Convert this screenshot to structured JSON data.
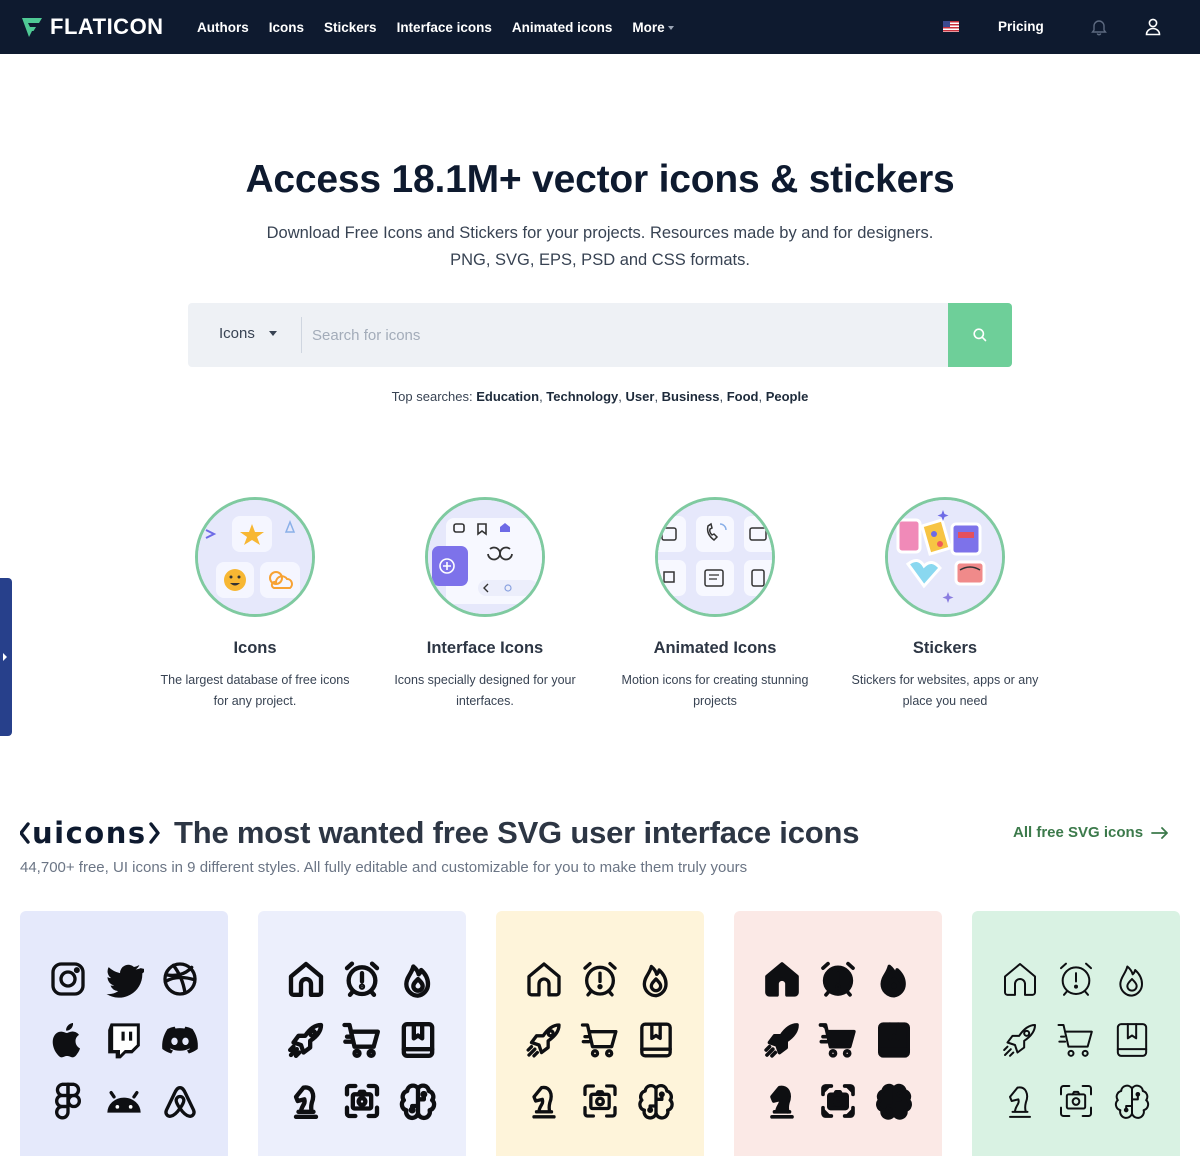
{
  "header": {
    "logo_text": "FLATICON",
    "nav": [
      "Authors",
      "Icons",
      "Stickers",
      "Interface icons",
      "Animated icons",
      "More"
    ],
    "pricing": "Pricing"
  },
  "hero": {
    "title": "Access 18.1M+ vector icons & stickers",
    "subtitle_line1": "Download Free Icons and Stickers for your projects. Resources made by and for designers.",
    "subtitle_line2": "PNG, SVG, EPS, PSD and CSS formats."
  },
  "search": {
    "type_label": "Icons",
    "placeholder": "Search for icons"
  },
  "top_searches": {
    "label": "Top searches:",
    "items": [
      "Education",
      "Technology",
      "User",
      "Business",
      "Food",
      "People"
    ]
  },
  "categories": [
    {
      "title": "Icons",
      "desc_line1": "The largest database of free icons",
      "desc_line2": "for any project."
    },
    {
      "title": "Interface Icons",
      "desc_line1": "Icons specially designed for your",
      "desc_line2": "interfaces."
    },
    {
      "title": "Animated Icons",
      "desc_line1": "Motion icons for creating stunning",
      "desc_line2": "projects"
    },
    {
      "title": "Stickers",
      "desc_line1": "Stickers for websites, apps or any",
      "desc_line2": "place you need"
    }
  ],
  "uicons": {
    "logo_text": "uicons",
    "title": "The most wanted free SVG user interface icons",
    "subtitle": "44,700+ free, UI icons in 9 different styles. All fully editable and customizable for you to make them truly yours",
    "all_link": "All free SVG icons"
  },
  "cards": [
    {
      "bg": "#e5e9fb",
      "icons": [
        "instagram-icon",
        "twitter-icon",
        "dribbble-icon",
        "apple-icon",
        "twitch-icon",
        "discord-icon",
        "figma-icon",
        "android-icon",
        "airbnb-icon"
      ]
    },
    {
      "bg": "#eceffc",
      "icons": [
        "home-icon",
        "alarm-icon",
        "flame-icon",
        "rocket-icon",
        "cart-icon",
        "book-icon",
        "chess-knight-icon",
        "camera-icon",
        "brain-icon"
      ]
    },
    {
      "bg": "#fef4da",
      "icons": [
        "home-icon",
        "alarm-icon",
        "flame-icon",
        "rocket-icon",
        "cart-icon",
        "book-icon",
        "chess-knight-icon",
        "camera-icon",
        "brain-icon"
      ]
    },
    {
      "bg": "#fbe9e6",
      "icons": [
        "home-icon",
        "alarm-icon",
        "flame-icon",
        "rocket-icon",
        "cart-icon",
        "book-icon",
        "chess-knight-icon",
        "camera-icon",
        "brain-icon"
      ]
    },
    {
      "bg": "#d9f2e3",
      "icons": [
        "home-icon",
        "alarm-icon",
        "flame-icon",
        "rocket-icon",
        "cart-icon",
        "book-icon",
        "chess-knight-icon",
        "camera-icon",
        "brain-icon"
      ]
    }
  ],
  "colors": {
    "header_bg": "#0e1a2f",
    "accent_green": "#6ecf99",
    "link_green": "#3c7a4b"
  }
}
